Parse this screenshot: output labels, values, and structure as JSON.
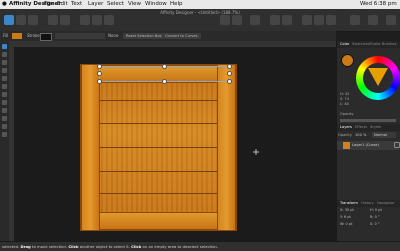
{
  "menubar": {
    "app_name": "Affinity Designer",
    "items": [
      "File",
      "Edit",
      "Text",
      "Layer",
      "Select",
      "View",
      "Window",
      "Help"
    ],
    "clock": "Wed 6:38 pm"
  },
  "toolbar": {
    "doc_title": "Affinity Designer - <Untitled> (188.7%)"
  },
  "contextbar": {
    "fill_label": "Fill",
    "stroke_label": "Stroke",
    "stroke_value": "None",
    "reset_button": "Reset Selection Box",
    "convert_button": "Convert to Curves"
  },
  "panel": {
    "top_tabs": [
      "Color",
      "Swatches",
      "Stroke",
      "Brushes"
    ],
    "hsl": {
      "h": "H: 42",
      "s": "S: 74",
      "l": "L: 48"
    },
    "opacity_label": "Opacity",
    "layer_tabs": [
      "Layers",
      "Effects",
      "Styles"
    ],
    "layer_opacity_label": "Opacity",
    "layer_opacity_value": "100 %",
    "blend_mode": "Normal",
    "layer_name": "Layer1 (Curve)",
    "bottom_tabs": [
      "Transform",
      "History",
      "Navigator"
    ],
    "transform": {
      "x": "X: 30 pt",
      "y": "Y: 6 pt",
      "w": "W: 0 pt",
      "h": "H: 0 pt",
      "r": "R: 0 °",
      "s": "S: 0 °"
    }
  },
  "status": {
    "text_1": "selected.",
    "drag": "Drag",
    "text_2": "to move selection.",
    "click1": "Click",
    "text_3": "another object to select it.",
    "click2": "Click",
    "text_4": "on an empty area to deselect selection."
  },
  "colors": {
    "accent": "#3b87c9",
    "wood": "#d08020",
    "canvas_bg": "#1b1b1b"
  }
}
